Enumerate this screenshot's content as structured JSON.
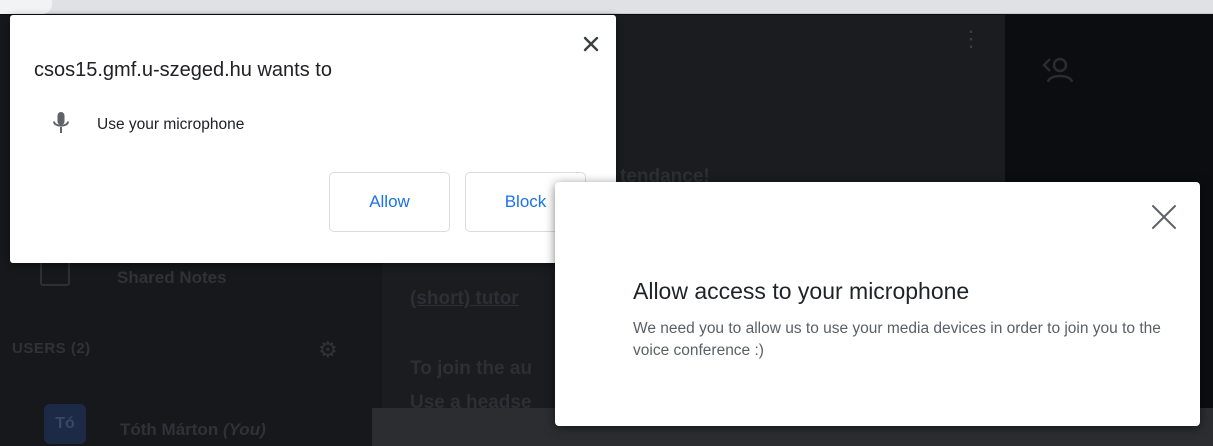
{
  "permission_popup": {
    "origin_text": "csos15.gmf.u-szeged.hu wants to",
    "permission_icon": "microphone-icon",
    "permission_text": "Use your microphone",
    "allow_label": "Allow",
    "block_label": "Block",
    "close_icon": "close-icon",
    "accent_color": "#1a73e8"
  },
  "access_modal": {
    "title": "Allow access to your microphone",
    "description": "We need you to allow us to use your media devices in order to join you to the voice conference :)",
    "close_icon": "close-icon"
  },
  "background_app": {
    "sidebar": {
      "shared_notes_label": "Shared Notes",
      "users_heading": "USERS (2)",
      "user": {
        "initials": "Tó",
        "name": "Tóth Márton",
        "you_suffix": "(You)"
      }
    },
    "main": {
      "line1_fragment": "tendance!",
      "line2_fragment": "(short) tutor",
      "line3_fragment": "To join the au",
      "line4_fragment": "Use a headse"
    }
  }
}
